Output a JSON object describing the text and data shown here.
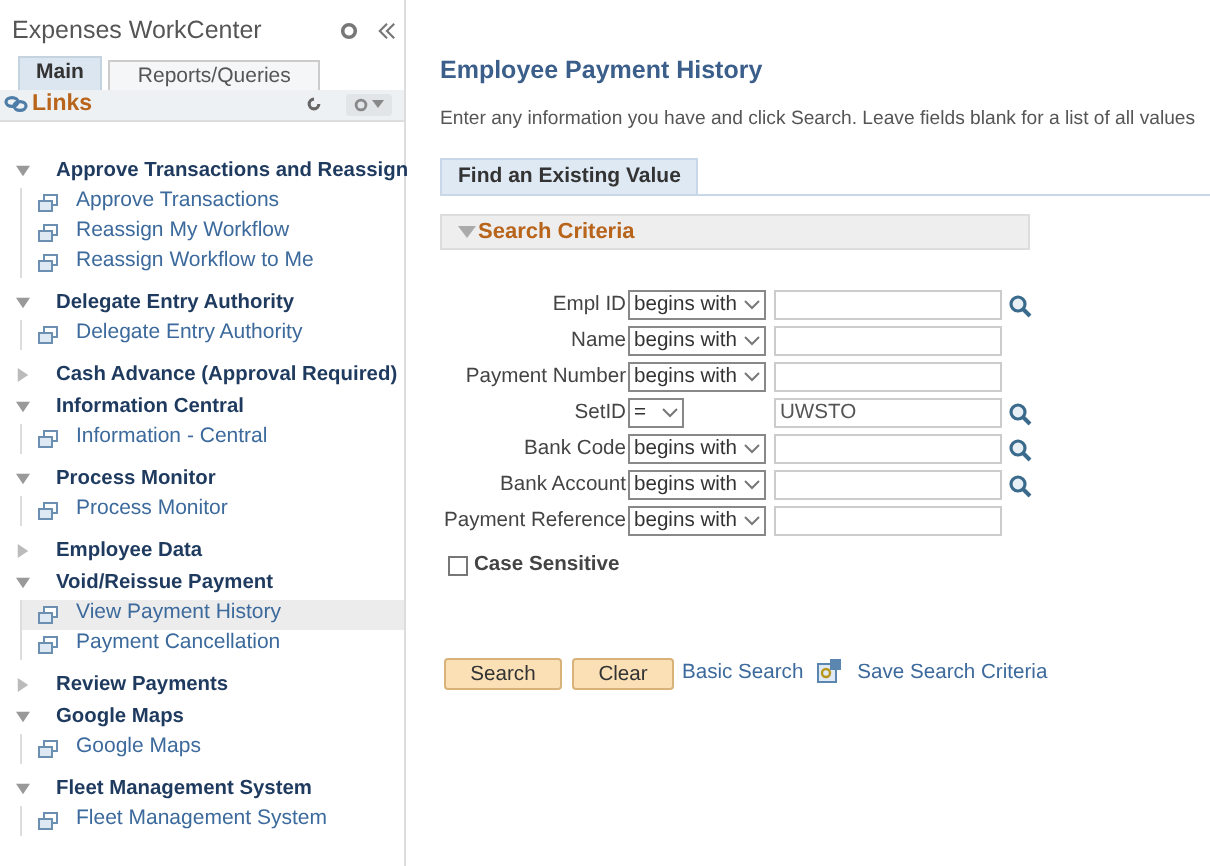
{
  "sidebar": {
    "title": "Expenses WorkCenter",
    "tabs": [
      {
        "label": "Main",
        "selected": true
      },
      {
        "label": "Reports/Queries",
        "selected": false
      }
    ],
    "links_title": "Links",
    "groups": [
      {
        "label": "Approve Transactions and Reassign",
        "expanded": true,
        "children": [
          {
            "label": "Approve Transactions",
            "selected": false
          },
          {
            "label": "Reassign My Workflow",
            "selected": false
          },
          {
            "label": "Reassign Workflow to Me",
            "selected": false
          }
        ]
      },
      {
        "label": "Delegate Entry Authority",
        "expanded": true,
        "children": [
          {
            "label": "Delegate Entry Authority",
            "selected": false
          }
        ]
      },
      {
        "label": "Cash Advance (Approval Required)",
        "expanded": false
      },
      {
        "label": "Information Central",
        "expanded": true,
        "children": [
          {
            "label": "Information - Central",
            "selected": false
          }
        ]
      },
      {
        "label": "Process Monitor",
        "expanded": true,
        "children": [
          {
            "label": "Process Monitor",
            "selected": false
          }
        ]
      },
      {
        "label": "Employee Data",
        "expanded": false
      },
      {
        "label": "Void/Reissue Payment",
        "expanded": true,
        "children": [
          {
            "label": "View Payment History",
            "selected": true
          },
          {
            "label": "Payment Cancellation",
            "selected": false
          }
        ]
      },
      {
        "label": "Review Payments",
        "expanded": false
      },
      {
        "label": "Google Maps",
        "expanded": true,
        "children": [
          {
            "label": "Google Maps",
            "selected": false
          }
        ]
      },
      {
        "label": "Fleet Management System",
        "expanded": true,
        "children": [
          {
            "label": "Fleet Management System",
            "selected": false
          }
        ]
      }
    ]
  },
  "main": {
    "title": "Employee Payment History",
    "instructions": "Enter any information you have and click Search. Leave fields blank for a list of all values",
    "tab": {
      "label": "Find an Existing Value",
      "selected": true
    },
    "section": {
      "title": "Search Criteria",
      "expanded": true
    },
    "fields": [
      {
        "label": "Empl ID",
        "operator": "begins with",
        "lookup": true
      },
      {
        "label": "Name",
        "operator": "begins with",
        "lookup": false
      },
      {
        "label": "Payment Number",
        "operator": "begins with",
        "lookup": false
      },
      {
        "label": "SetID",
        "operator": "=",
        "value": "UWSTO",
        "lookup": true
      },
      {
        "label": "Bank Code",
        "operator": "begins with",
        "lookup": true
      },
      {
        "label": "Bank Account",
        "operator": "begins with",
        "lookup": true
      },
      {
        "label": "Payment Reference",
        "operator": "begins with",
        "lookup": false
      }
    ],
    "case_sensitive": {
      "label": "Case Sensitive",
      "checked": false
    },
    "buttons": [
      "Search",
      "Clear"
    ],
    "links": [
      "Basic Search",
      "Save Search Criteria"
    ]
  }
}
